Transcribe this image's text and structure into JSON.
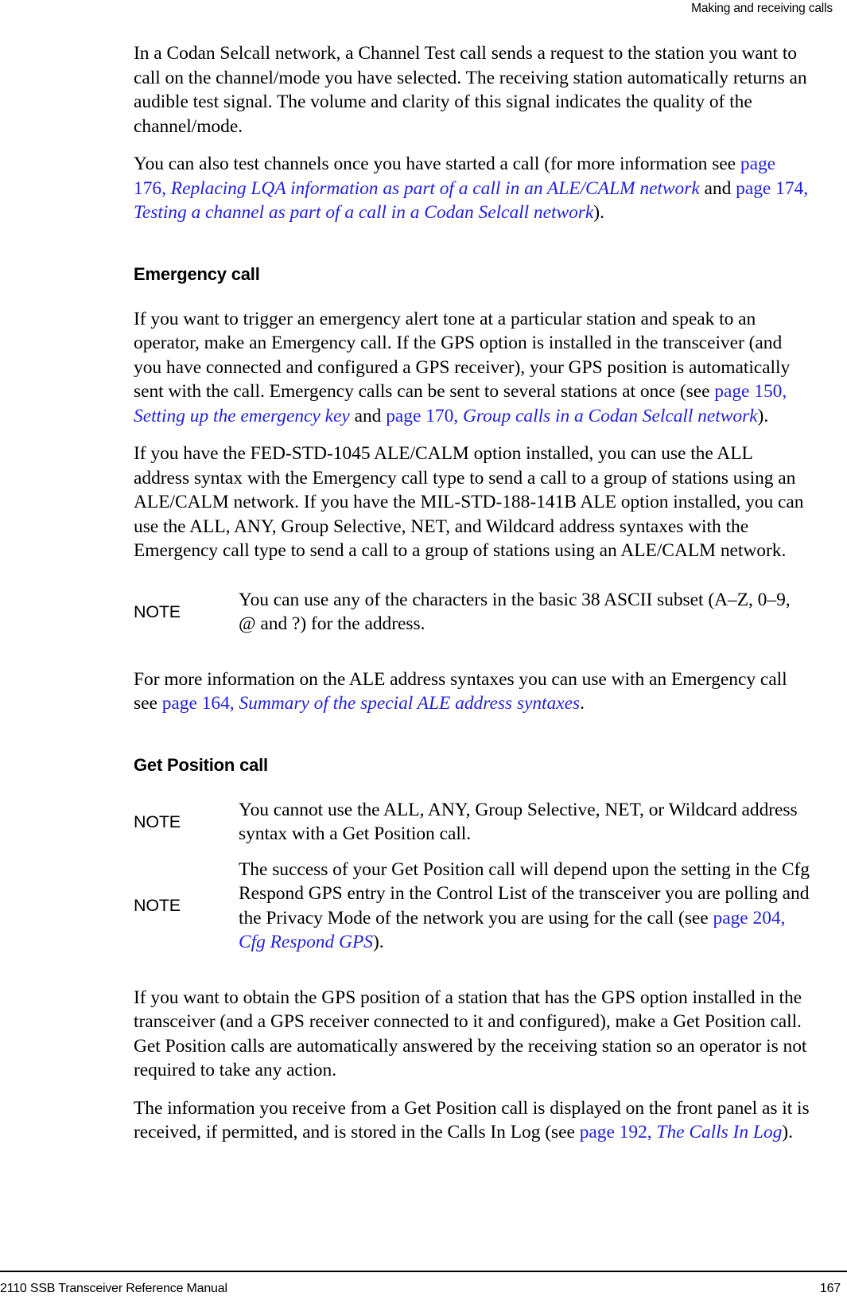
{
  "header": {
    "running_head": "Making and receiving calls"
  },
  "footer": {
    "manual_title": "2110 SSB Transceiver Reference Manual",
    "page_number": "167"
  },
  "colors": {
    "text": "#000000",
    "link": "#2222dd",
    "background": "#ffffff"
  },
  "sections": {
    "channel_test": {
      "para1": "In a Codan Selcall network, a Channel Test call sends a request to the station you want to call on the channel/mode you have selected. The receiving station automatically returns an audible test signal. The volume and clarity of this signal indicates the quality of the channel/mode.",
      "para2_lead": "You can also test channels once you have started a call (for more information see ",
      "para2_link1_page": "page 176,",
      "para2_link1_title": " Replacing LQA information as part of a call in an ALE/CALM network",
      "para2_mid": " and ",
      "para2_link2_page": "page 174,",
      "para2_link2_title": " Testing a channel as part of a call in a Codan Selcall network",
      "para2_tail": ")."
    },
    "emergency_call": {
      "heading": "Emergency call",
      "para1_lead": "If you want to trigger an emergency alert tone at a particular station and speak to an operator, make an Emergency call. If the GPS option is installed in the transceiver (and you have connected and configured a GPS receiver), your GPS position is automatically sent with the call. Emergency calls can be sent to several stations at once (see ",
      "para1_link1_page": "page 150,",
      "para1_link1_title": " Setting up the emergency key",
      "para1_mid": " and ",
      "para1_link2_page": "page 170,",
      "para1_link2_title": " Group calls in a Codan Selcall network",
      "para1_tail": ").",
      "para2": "If you have the FED-STD-1045 ALE/CALM option installed, you can use the ALL address syntax with the Emergency call type to send a call to a group of stations using an ALE/CALM network. If you have the MIL-STD-188-141B ALE option installed, you can use the ALL, ANY, Group Selective, NET, and Wildcard address syntaxes with the Emergency call type to send a call to a group of stations using an ALE/CALM network.",
      "note1_label": "NOTE",
      "note1_body": "You can use any of the characters in the basic 38 ASCII subset (A–Z, 0–9, @ and ?) for the address.",
      "para3_lead": "For more information on the ALE address syntaxes you can use with an Emergency call see ",
      "para3_link_page": "page 164,",
      "para3_link_title": " Summary of the special ALE address syntaxes",
      "para3_tail": "."
    },
    "get_position_call": {
      "heading": "Get Position call",
      "note1_label": "NOTE",
      "note1_body": "You cannot use the ALL, ANY, Group Selective, NET, or Wildcard address syntax with a Get Position call.",
      "note2_label": "NOTE",
      "note2_lead": "The success of your Get Position call will depend upon the setting in the Cfg Respond GPS entry in the Control List of the transceiver you are polling and the Privacy Mode of the network you are using for the call (see ",
      "note2_link_page": "page 204,",
      "note2_link_title": " Cfg Respond GPS",
      "note2_tail": ").",
      "para1": "If you want to obtain the GPS position of a station that has the GPS option installed in the transceiver (and a GPS receiver connected to it and configured), make a Get Position call. Get Position calls are automatically answered by the receiving station so an operator is not required to take any action.",
      "para2_lead": "The information you receive from a Get Position call is displayed on the front panel as it is received, if permitted, and is stored in the Calls In Log (see ",
      "para2_link_page": "page 192,",
      "para2_link_title": " The Calls In Log",
      "para2_tail": ")."
    }
  }
}
